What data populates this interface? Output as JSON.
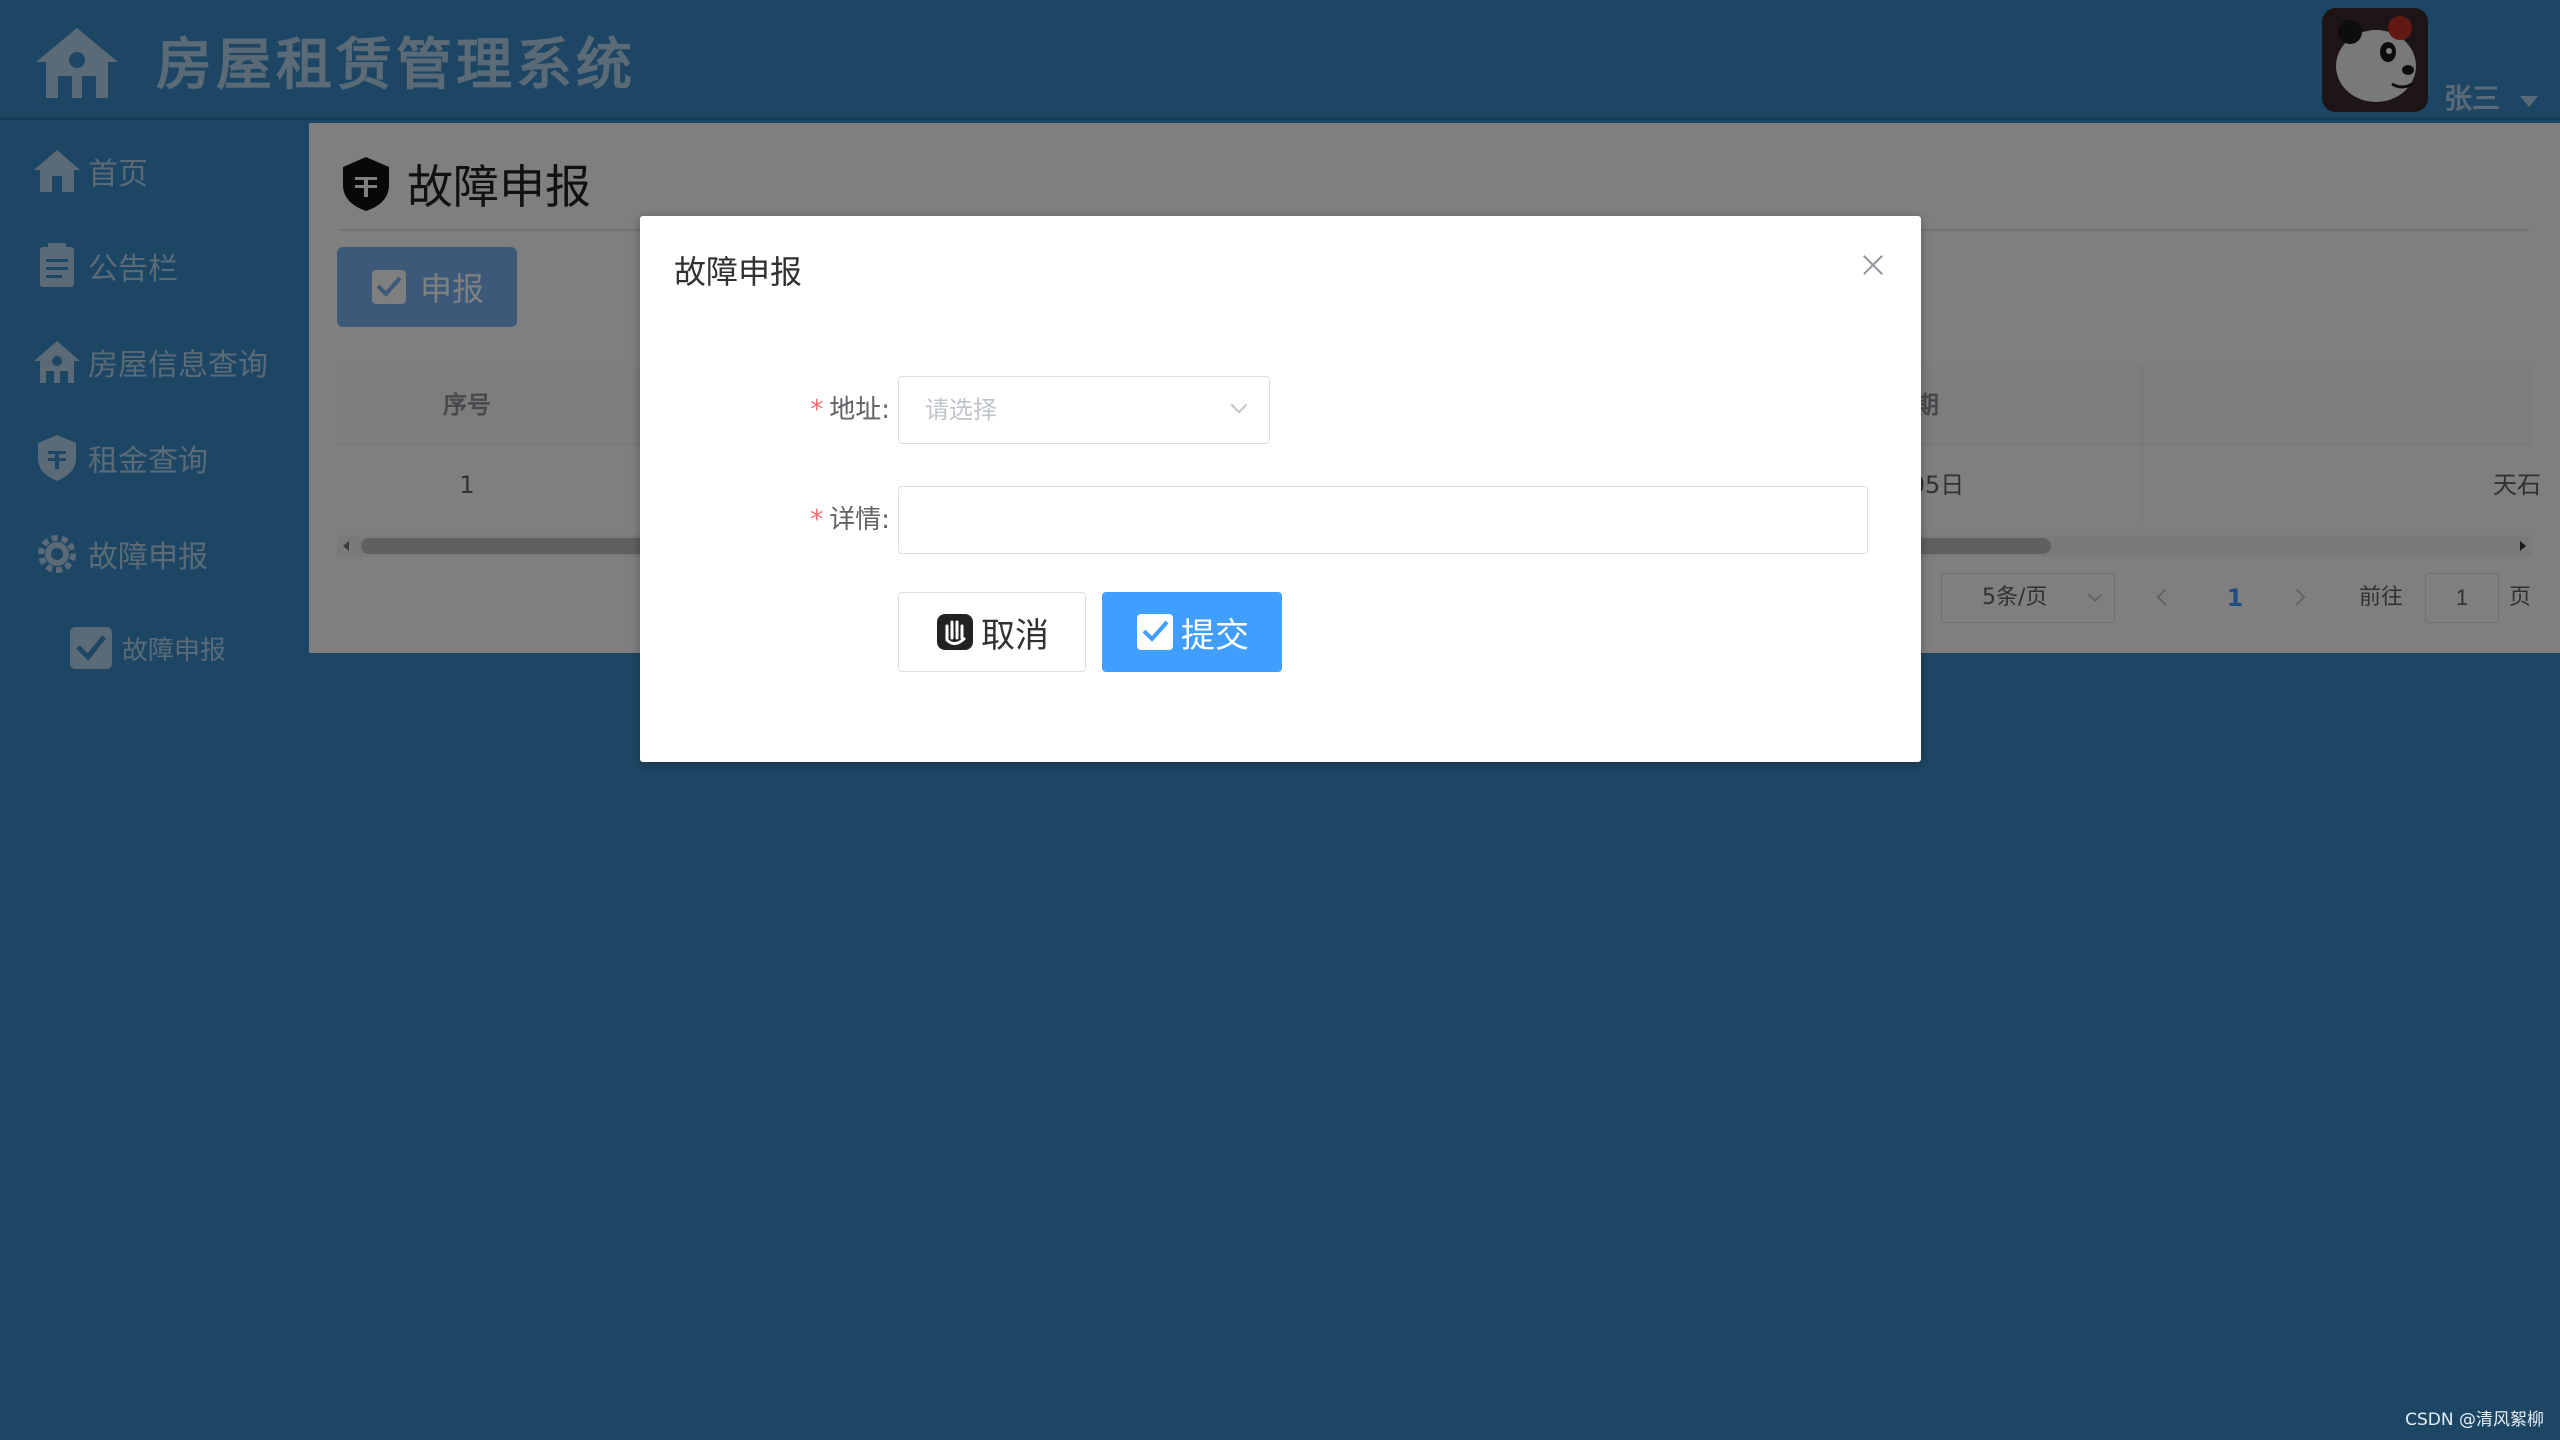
{
  "header": {
    "app_title": "房屋租赁管理系统",
    "user_name": "张三"
  },
  "sidebar": {
    "items": [
      {
        "label": "首页",
        "icon": "home-icon"
      },
      {
        "label": "公告栏",
        "icon": "notice-icon"
      },
      {
        "label": "房屋信息查询",
        "icon": "house-icon"
      },
      {
        "label": "租金查询",
        "icon": "money-icon"
      },
      {
        "label": "故障申报",
        "icon": "gear-icon"
      },
      {
        "label": "故障申报",
        "icon": "checkbox-icon"
      }
    ]
  },
  "main": {
    "page_title": "故障申报",
    "report_button_label": "申报",
    "table": {
      "headers": [
        "序号",
        "",
        "",
        "",
        "期",
        ""
      ],
      "rows": [
        [
          "1",
          "",
          "",
          "",
          "05日",
          "天石"
        ]
      ]
    },
    "pagination": {
      "page_size": "5条/页",
      "current_page": "1",
      "goto_label": "前往",
      "goto_value": "1",
      "page_suffix": "页"
    }
  },
  "dialog": {
    "title": "故障申报",
    "address_label": "地址:",
    "address_placeholder": "请选择",
    "detail_label": "详情:",
    "detail_value": "",
    "required_mark": "*",
    "cancel_label": "取消",
    "submit_label": "提交"
  },
  "watermark": "CSDN @清风絮柳",
  "colors": {
    "brand_blue": "#3a8cc8",
    "primary": "#409eff",
    "required": "#f56c6c"
  }
}
